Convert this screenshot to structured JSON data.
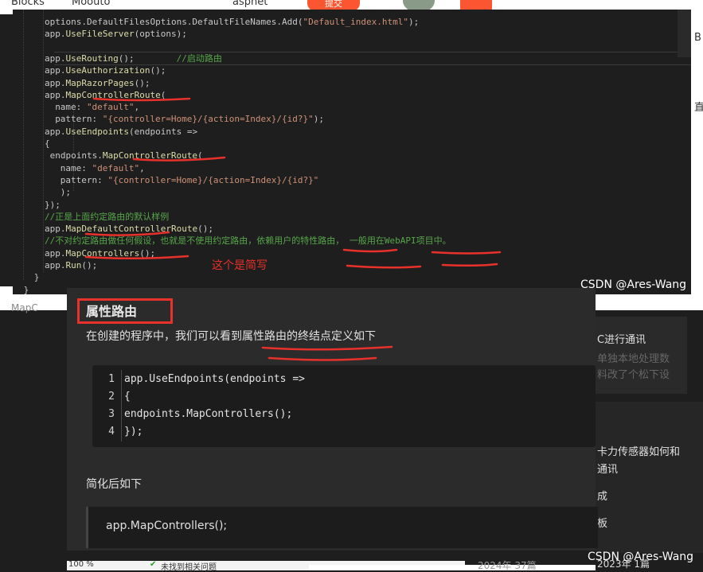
{
  "background_page": {
    "tabs": [
      "Blocks",
      "Moouto",
      "aspnet"
    ],
    "orange_button": "提交",
    "left_label": "MapC",
    "right_strip_chars": [
      "B",
      "直"
    ],
    "side_panel": {
      "items": [
        "C进行通讯",
        "单独本地处理数",
        "料改了个松下设",
        "卡力传感器如何和",
        "通讯",
        "成",
        "板"
      ]
    },
    "status_bar": {
      "zoom": "100 %",
      "issues": "未找到相关问题"
    },
    "bottom_texts": [
      "2024年 37篇",
      "2023年 1篇"
    ]
  },
  "editor": {
    "lines": [
      {
        "indent": 4,
        "parts": [
          [
            "pl",
            "options."
          ],
          [
            "pl",
            "DefaultFilesOptions.DefaultFileNames.Add("
          ],
          [
            "str",
            "\"Default_index.html\""
          ],
          [
            "pl",
            ");"
          ]
        ]
      },
      {
        "indent": 4,
        "parts": [
          [
            "pl",
            "app."
          ],
          [
            "fn",
            "UseFileServer"
          ],
          [
            "pl",
            "(options);"
          ]
        ]
      },
      {
        "indent": 0,
        "parts": []
      },
      {
        "indent": 4,
        "parts": [
          [
            "pl",
            "app."
          ],
          [
            "fn",
            "UseRouting"
          ],
          [
            "pl",
            "();        "
          ],
          [
            "cm",
            "//启动路由"
          ]
        ]
      },
      {
        "indent": 4,
        "parts": [
          [
            "pl",
            "app."
          ],
          [
            "fn",
            "UseAuthorization"
          ],
          [
            "pl",
            "();"
          ]
        ]
      },
      {
        "indent": 4,
        "parts": [
          [
            "pl",
            "app."
          ],
          [
            "fn",
            "MapRazorPages"
          ],
          [
            "pl",
            "();"
          ]
        ]
      },
      {
        "indent": 4,
        "parts": [
          [
            "pl",
            "app."
          ],
          [
            "fn",
            "MapControllerRoute"
          ],
          [
            "pl",
            "("
          ]
        ]
      },
      {
        "indent": 6,
        "parts": [
          [
            "pl",
            "name: "
          ],
          [
            "str",
            "\"default\""
          ],
          [
            "pl",
            ","
          ]
        ]
      },
      {
        "indent": 6,
        "parts": [
          [
            "pl",
            "pattern: "
          ],
          [
            "str",
            "\"{controller=Home}/{action=Index}/{id?}\""
          ],
          [
            "pl",
            ");"
          ]
        ]
      },
      {
        "indent": 4,
        "parts": [
          [
            "pl",
            "app."
          ],
          [
            "fn",
            "UseEndpoints"
          ],
          [
            "pl",
            "(endpoints =>"
          ]
        ]
      },
      {
        "indent": 4,
        "parts": [
          [
            "pl",
            "{"
          ]
        ]
      },
      {
        "indent": 5,
        "parts": [
          [
            "pl",
            "endpoints."
          ],
          [
            "fn",
            "MapControllerRoute"
          ],
          [
            "pl",
            "("
          ]
        ]
      },
      {
        "indent": 7,
        "parts": [
          [
            "pl",
            "name: "
          ],
          [
            "str",
            "\"default\""
          ],
          [
            "pl",
            ","
          ]
        ]
      },
      {
        "indent": 7,
        "parts": [
          [
            "pl",
            "pattern: "
          ],
          [
            "str",
            "\"{controller=Home}/{action=Index}/{id?}\""
          ]
        ]
      },
      {
        "indent": 7,
        "parts": [
          [
            "pl",
            ");"
          ]
        ]
      },
      {
        "indent": 4,
        "parts": [
          [
            "pl",
            "});"
          ]
        ]
      },
      {
        "indent": 4,
        "parts": [
          [
            "cm",
            "//正是上面约定路由的默认样例"
          ]
        ]
      },
      {
        "indent": 4,
        "parts": [
          [
            "pl",
            "app."
          ],
          [
            "fn",
            "MapDefaultControllerRoute"
          ],
          [
            "pl",
            "();"
          ]
        ]
      },
      {
        "indent": 4,
        "parts": [
          [
            "cm",
            "//不对约定路由做任何假设，也就是不使用约定路由，依赖用户的特性路由， 一般用在WebAPI项目中。"
          ]
        ]
      },
      {
        "indent": 4,
        "parts": [
          [
            "pl",
            "app."
          ],
          [
            "fn",
            "MapControllers"
          ],
          [
            "pl",
            "();"
          ]
        ]
      },
      {
        "indent": 4,
        "parts": [
          [
            "pl",
            "app."
          ],
          [
            "fn",
            "Run"
          ],
          [
            "pl",
            "();"
          ]
        ]
      },
      {
        "indent": 2,
        "parts": [
          [
            "pl",
            "}"
          ]
        ]
      },
      {
        "indent": 0,
        "parts": [
          [
            "pl",
            "}"
          ]
        ]
      }
    ],
    "annotation": "这个是简写",
    "watermark": "CSDN @Ares-Wang"
  },
  "article": {
    "heading": "属性路由",
    "intro": "在创建的程序中，我们可以看到属性路由的终结点定义如下",
    "code_lines": [
      "app.UseEndpoints(endpoints =>",
      "{",
      "endpoints.MapControllers();",
      "});"
    ],
    "line_numbers": [
      "1",
      "2",
      "3",
      "4"
    ],
    "subheading": "简化后如下",
    "simplified_code": "app.MapControllers();",
    "watermark": "CSDN @Ares-Wang"
  },
  "colors": {
    "annotation_red": "#e8312a",
    "csdn_orange": "#fc5531",
    "code_function": "#dcdcaa",
    "code_string": "#ce9178",
    "code_comment": "#57a64a"
  }
}
